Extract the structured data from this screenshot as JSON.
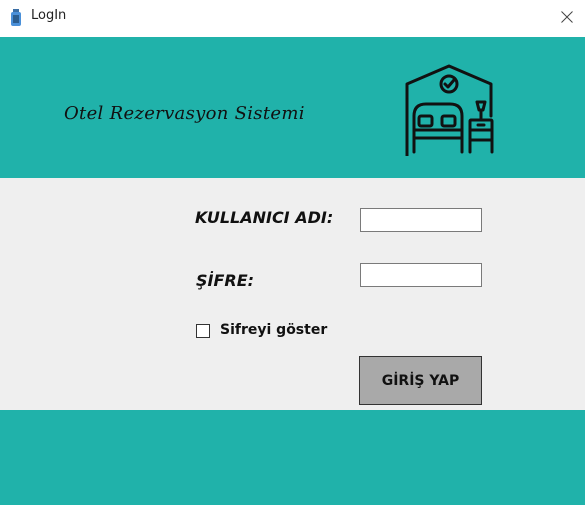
{
  "window": {
    "title": "LogIn",
    "app_icon": "app-bottle-icon",
    "close_icon": "close-icon"
  },
  "header": {
    "brand": "Otel Rezervasyon Sistemi",
    "icon": "hotel-bed-icon",
    "bg_color": "#20b2aa"
  },
  "form": {
    "username_label": "KULLANICI ADI:",
    "username_value": "",
    "password_label": "ŞİFRE:",
    "password_value": "",
    "show_password_label": "Sifreyi göster",
    "show_password_checked": false,
    "login_button": "GİRİŞ YAP",
    "bg_color": "#efefef"
  }
}
